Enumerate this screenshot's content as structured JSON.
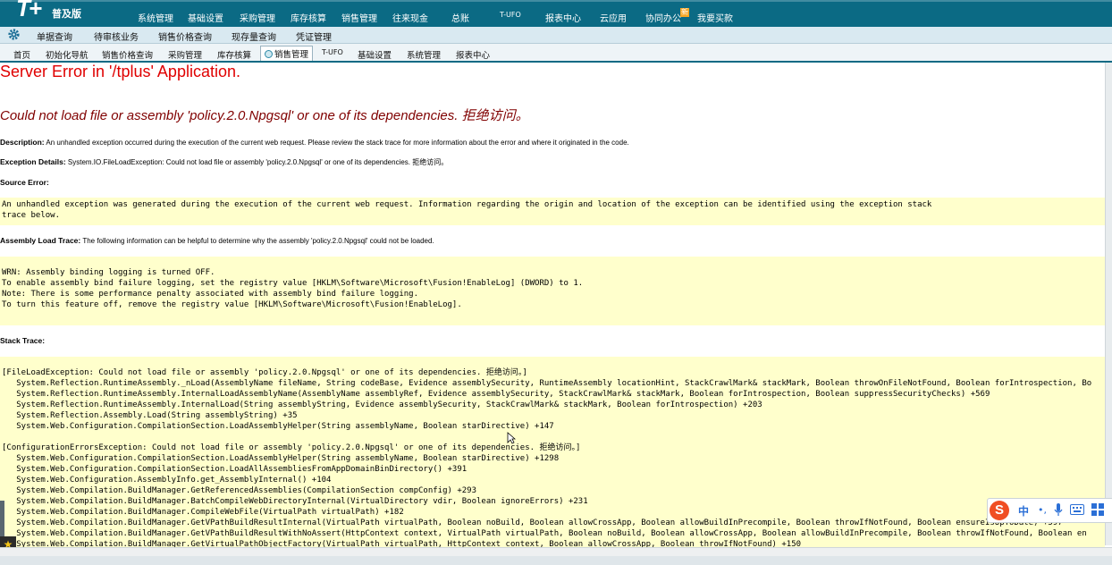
{
  "app": {
    "logo": "T+",
    "edition": "普及版",
    "top_nav": [
      "系统管理",
      "基础设置",
      "采购管理",
      "库存核算",
      "销售管理",
      "往来现金",
      "总账",
      "T-UFO",
      "报表中心",
      "云应用",
      "协同办公",
      "我要买款"
    ],
    "new_badge": "新"
  },
  "toolbar": {
    "items": [
      "单据查询",
      "待审核业务",
      "销售价格查询",
      "现存量查询",
      "凭证管理"
    ]
  },
  "tabs": {
    "items": [
      "首页",
      "初始化导航",
      "销售价格查询",
      "采购管理",
      "库存核算",
      "销售管理",
      "T-UFO",
      "基础设置",
      "系统管理",
      "报表中心"
    ],
    "active_index": 5
  },
  "error": {
    "title": "Server Error in '/tplus' Application.",
    "subtitle": "Could not load file or assembly 'policy.2.0.Npgsql' or one of its dependencies. 拒绝访问。",
    "description_label": "Description:",
    "description_text": " An unhandled exception occurred during the execution of the current web request. Please review the stack trace for more information about the error and where it originated in the code.",
    "exception_label": "Exception Details:",
    "exception_text": " System.IO.FileLoadException: Could not load file or assembly 'policy.2.0.Npgsql' or one of its dependencies. 拒绝访问。",
    "source_label": "Source Error:",
    "source_code": "An unhandled exception was generated during the execution of the current web request. Information regarding the origin and location of the exception can be identified using the exception stack\ntrace below.",
    "assembly_label": "Assembly Load Trace:",
    "assembly_text": " The following information can be helpful to determine why the assembly 'policy.2.0.Npgsql' could not be loaded.",
    "assembly_code": "\nWRN: Assembly binding logging is turned OFF.\nTo enable assembly bind failure logging, set the registry value [HKLM\\Software\\Microsoft\\Fusion!EnableLog] (DWORD) to 1.\nNote: There is some performance penalty associated with assembly bind failure logging.\nTo turn this feature off, remove the registry value [HKLM\\Software\\Microsoft\\Fusion!EnableLog].",
    "stack_label": "Stack Trace:",
    "stack_code": "\n[FileLoadException: Could not load file or assembly 'policy.2.0.Npgsql' or one of its dependencies. 拒绝访问。]\n   System.Reflection.RuntimeAssembly._nLoad(AssemblyName fileName, String codeBase, Evidence assemblySecurity, RuntimeAssembly locationHint, StackCrawlMark& stackMark, Boolean throwOnFileNotFound, Boolean forIntrospection, Bo\n   System.Reflection.RuntimeAssembly.InternalLoadAssemblyName(AssemblyName assemblyRef, Evidence assemblySecurity, StackCrawlMark& stackMark, Boolean forIntrospection, Boolean suppressSecurityChecks) +569\n   System.Reflection.RuntimeAssembly.InternalLoad(String assemblyString, Evidence assemblySecurity, StackCrawlMark& stackMark, Boolean forIntrospection) +203\n   System.Reflection.Assembly.Load(String assemblyString) +35\n   System.Web.Configuration.CompilationSection.LoadAssemblyHelper(String assemblyName, Boolean starDirective) +147\n\n[ConfigurationErrorsException: Could not load file or assembly 'policy.2.0.Npgsql' or one of its dependencies. 拒绝访问。]\n   System.Web.Configuration.CompilationSection.LoadAssemblyHelper(String assemblyName, Boolean starDirective) +1298\n   System.Web.Configuration.CompilationSection.LoadAllAssembliesFromAppDomainBinDirectory() +391\n   System.Web.Configuration.AssemblyInfo.get_AssemblyInternal() +104\n   System.Web.Compilation.BuildManager.GetReferencedAssemblies(CompilationSection compConfig) +293\n   System.Web.Compilation.BuildManager.BatchCompileWebDirectoryInternal(VirtualDirectory vdir, Boolean ignoreErrors) +231\n   System.Web.Compilation.BuildManager.CompileWebFile(VirtualPath virtualPath) +182\n   System.Web.Compilation.BuildManager.GetVPathBuildResultInternal(VirtualPath virtualPath, Boolean noBuild, Boolean allowCrossApp, Boolean allowBuildInPrecompile, Boolean throwIfNotFound, Boolean ensureIsUpToDate) +597\n   System.Web.Compilation.BuildManager.GetVPathBuildResultWithNoAssert(HttpContext context, VirtualPath virtualPath, Boolean noBuild, Boolean allowCrossApp, Boolean allowBuildInPrecompile, Boolean throwIfNotFound, Boolean en\n   System.Web.Compilation.BuildManager.GetVirtualPathObjectFactory(VirtualPath virtualPath, HttpContext context, Boolean allowCrossApp, Boolean throwIfNotFound) +150"
  },
  "ime": {
    "logo": "S",
    "mode": "中",
    "icons": [
      "punctuation-icon",
      "microphone-icon",
      "keyboard-icon",
      "grid-icon"
    ]
  },
  "colors": {
    "topbar": "#0b6a84",
    "error_title": "#e00000",
    "error_subtitle": "#800000",
    "code_background": "#ffffcc"
  }
}
